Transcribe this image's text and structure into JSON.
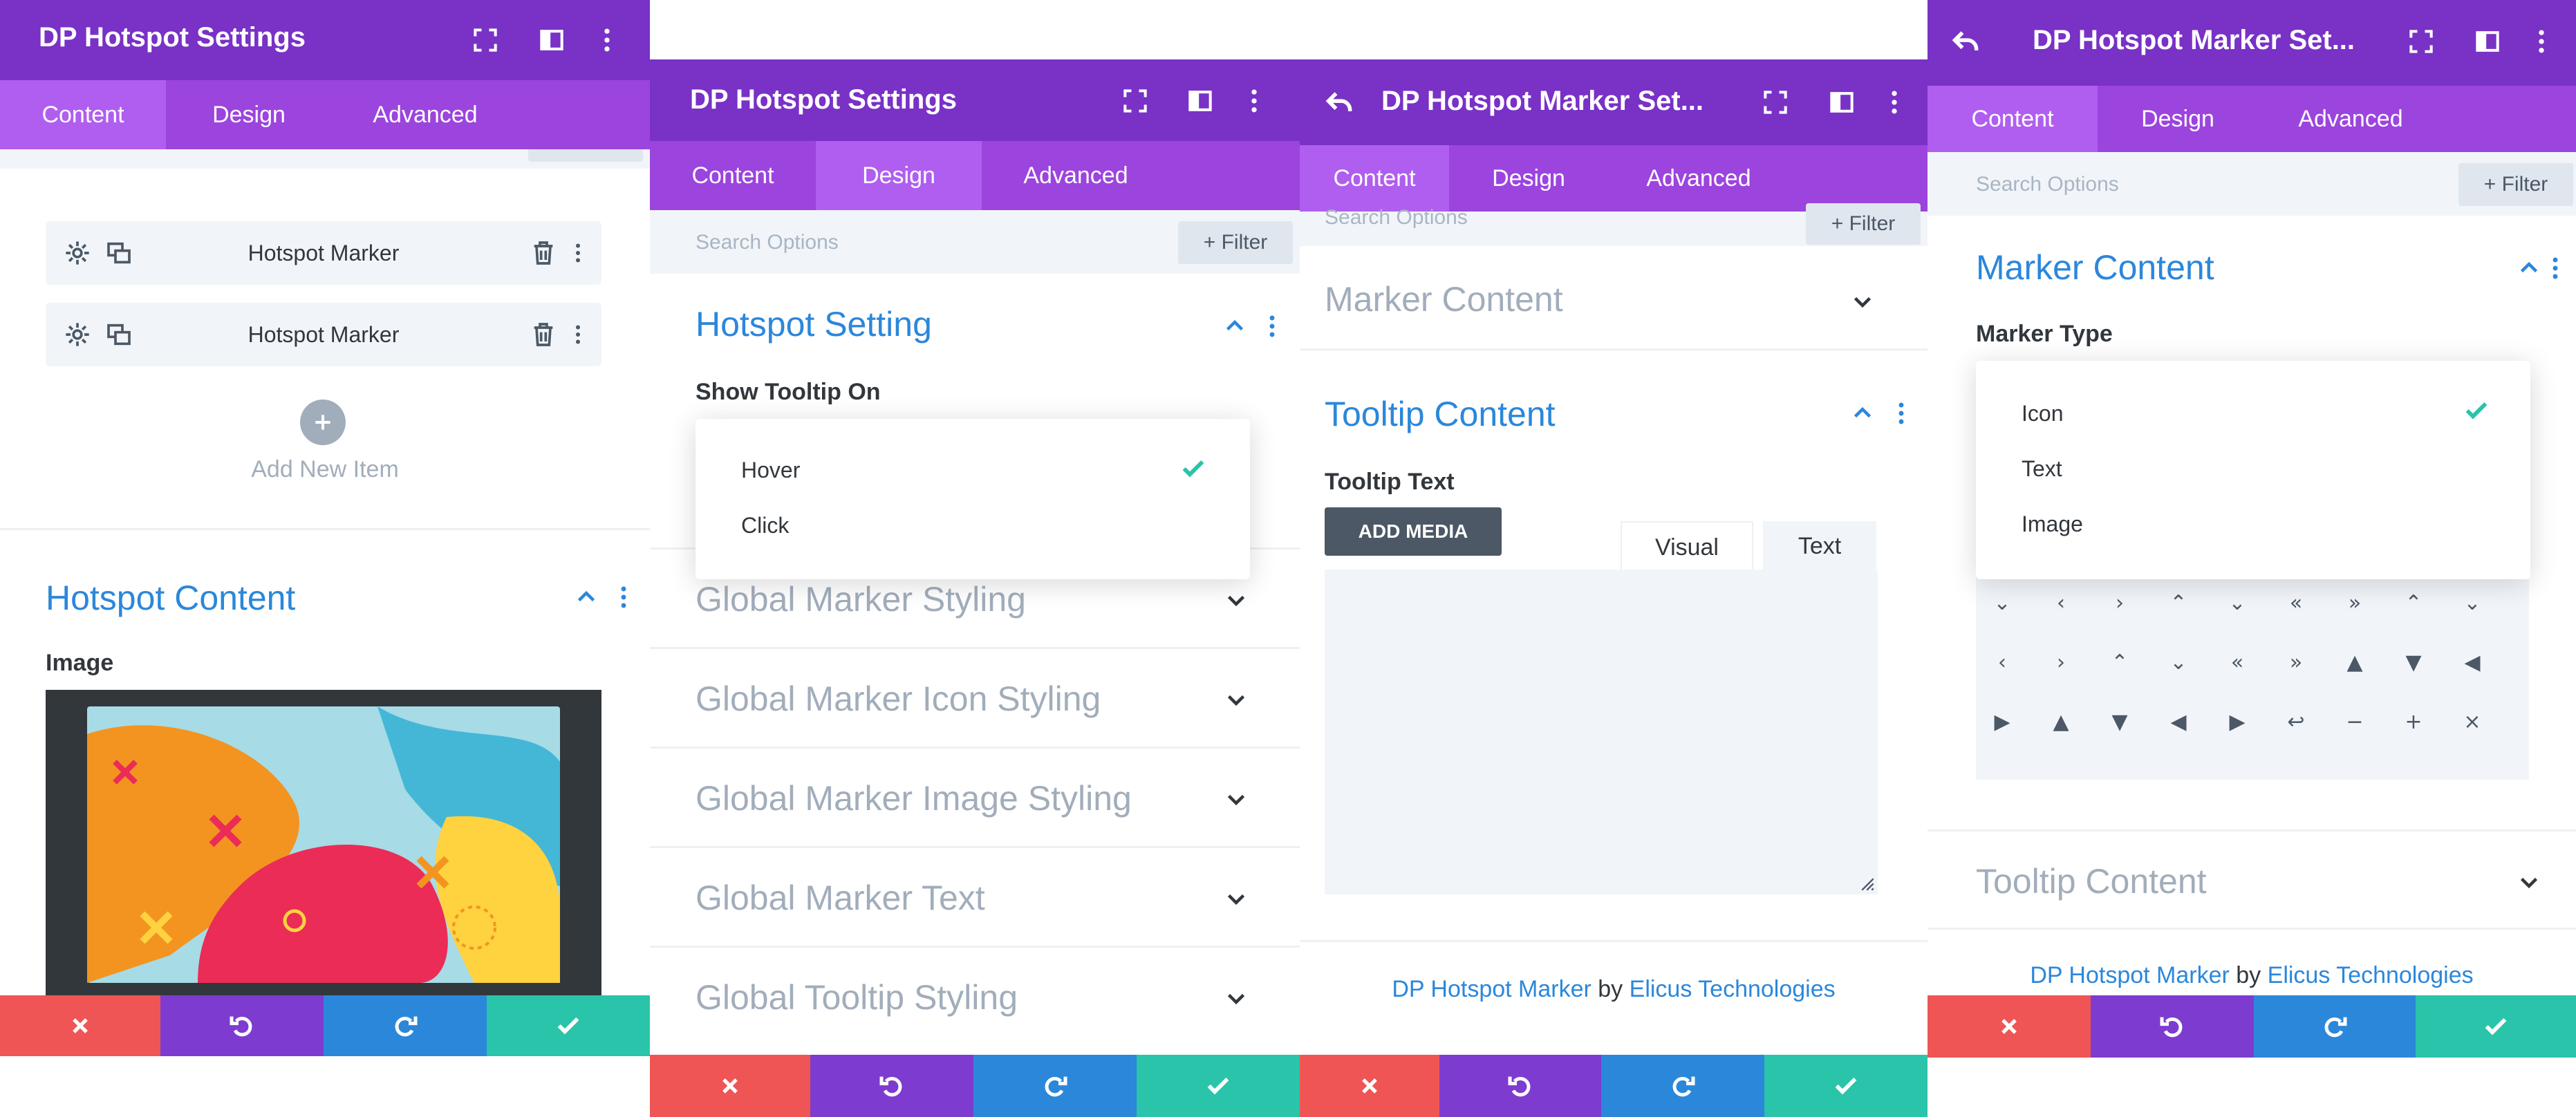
{
  "colors": {
    "header": "#7931c6",
    "tabs": "#9c44de",
    "tab_active": "#b05ef0",
    "accent_blue": "#2b87da",
    "check_green": "#29c4a9",
    "footer_red": "#ef5555",
    "footer_purple": "#7e3bd0",
    "footer_blue": "#2b87da",
    "footer_teal": "#29c4a9"
  },
  "panel1": {
    "title": "DP Hotspot Settings",
    "tabs": [
      "Content",
      "Design",
      "Advanced"
    ],
    "items": [
      "Hotspot Marker",
      "Hotspot Marker"
    ],
    "add_new_item": "Add New Item",
    "section_title": "Hotspot Content",
    "image_label": "Image"
  },
  "panel2": {
    "title": "DP Hotspot Settings",
    "tabs": [
      "Content",
      "Design",
      "Advanced"
    ],
    "search_placeholder": "Search Options",
    "filter_label": "Filter",
    "section_title": "Hotspot Setting",
    "field_label": "Show Tooltip On",
    "options": [
      "Hover",
      "Click"
    ],
    "selected_option": "Hover",
    "collapsed_sections": [
      "Global Marker Styling",
      "Global Marker Icon Styling",
      "Global Marker Image Styling",
      "Global Marker Text",
      "Global Tooltip Styling"
    ]
  },
  "panel3": {
    "title": "DP Hotspot Marker Set...",
    "tabs": [
      "Content",
      "Design",
      "Advanced"
    ],
    "search_placeholder": "Search Options",
    "filter_label": "Filter",
    "collapsed_section": "Marker Content",
    "section_title": "Tooltip Content",
    "field_label": "Tooltip Text",
    "add_media": "ADD MEDIA",
    "editor_tabs": [
      "Visual",
      "Text"
    ],
    "credit_product": "DP Hotspot Marker",
    "credit_by": "by",
    "credit_company": "Elicus Technologies"
  },
  "panel4": {
    "title": "DP Hotspot Marker Set...",
    "tabs": [
      "Content",
      "Design",
      "Advanced"
    ],
    "search_placeholder": "Search Options",
    "filter_label": "Filter",
    "section_title": "Marker Content",
    "field_label": "Marker Type",
    "options": [
      "Icon",
      "Text",
      "Image"
    ],
    "selected_option": "Icon",
    "icon_glyphs": [
      "⌄",
      "‹",
      "›",
      "⌃",
      "⌄",
      "«",
      "»",
      "⌃",
      "⌄",
      "‹",
      "›",
      "⌃",
      "⌄",
      "«",
      "»",
      "▲",
      "▼",
      "◀",
      "▶",
      "▲",
      "▼",
      "◀",
      "▶",
      "↩",
      "−",
      "+",
      "×"
    ],
    "icon_names": [
      "chevron-down-icon",
      "chevron-left-icon",
      "chevron-right-icon",
      "double-chevron-up-icon",
      "double-chevron-down-icon",
      "double-chevron-left-icon",
      "double-chevron-right-icon",
      "circle-chevron-up-icon",
      "circle-chevron-down-icon",
      "circle-chevron-left-icon",
      "circle-chevron-right-icon",
      "circle-double-up-icon",
      "circle-double-down-icon",
      "circle-double-left-icon",
      "circle-double-right-icon",
      "triangle-up-icon",
      "triangle-down-icon",
      "triangle-left-icon",
      "triangle-right-icon",
      "circle-triangle-up-icon",
      "circle-triangle-down-icon",
      "circle-triangle-left-icon",
      "circle-triangle-right-icon",
      "undo-arrow-icon",
      "minus-icon",
      "plus-icon",
      "close-x-icon"
    ],
    "collapsed_section": "Tooltip Content",
    "credit_product": "DP Hotspot Marker",
    "credit_by": "by",
    "credit_company": "Elicus Technologies"
  }
}
